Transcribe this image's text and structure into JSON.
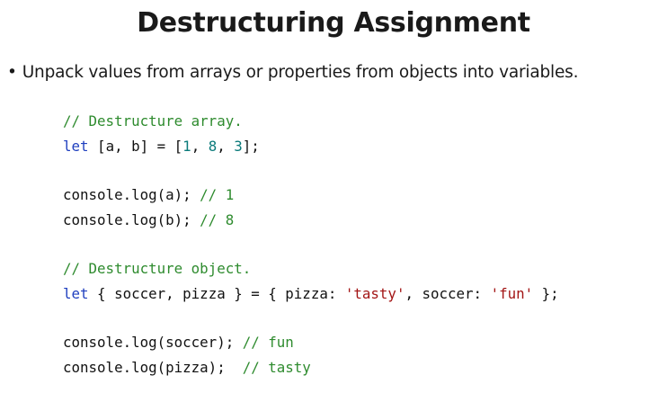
{
  "slide": {
    "title": "Destructuring Assignment",
    "bullet_marker": "•",
    "bullet_text": "Unpack values from arrays or properties from objects into variables."
  },
  "code": {
    "lines": [
      [
        {
          "text": "// Destructure array.",
          "kind": "comment"
        }
      ],
      [
        {
          "text": "let",
          "kind": "keyword"
        },
        {
          "text": " [a, b] = [",
          "kind": "plain"
        },
        {
          "text": "1",
          "kind": "number"
        },
        {
          "text": ", ",
          "kind": "plain"
        },
        {
          "text": "8",
          "kind": "number"
        },
        {
          "text": ", ",
          "kind": "plain"
        },
        {
          "text": "3",
          "kind": "number"
        },
        {
          "text": "];",
          "kind": "plain"
        }
      ],
      [],
      [
        {
          "text": "console.log(a); ",
          "kind": "plain"
        },
        {
          "text": "// 1",
          "kind": "comment"
        }
      ],
      [
        {
          "text": "console.log(b); ",
          "kind": "plain"
        },
        {
          "text": "// 8",
          "kind": "comment"
        }
      ],
      [],
      [
        {
          "text": "// Destructure object.",
          "kind": "comment"
        }
      ],
      [
        {
          "text": "let",
          "kind": "keyword"
        },
        {
          "text": " { soccer, pizza } = { pizza: ",
          "kind": "plain"
        },
        {
          "text": "'tasty'",
          "kind": "string"
        },
        {
          "text": ", soccer: ",
          "kind": "plain"
        },
        {
          "text": "'fun'",
          "kind": "string"
        },
        {
          "text": " };",
          "kind": "plain"
        }
      ],
      [],
      [
        {
          "text": "console.log(soccer); ",
          "kind": "plain"
        },
        {
          "text": "// fun",
          "kind": "comment"
        }
      ],
      [
        {
          "text": "console.log(pizza);  ",
          "kind": "plain"
        },
        {
          "text": "// tasty",
          "kind": "comment"
        }
      ]
    ]
  },
  "colors": {
    "comment": "#2e8b2e",
    "keyword": "#1f3fbf",
    "number": "#0a7a7a",
    "string": "#a31515",
    "text": "#111111",
    "background": "#ffffff"
  }
}
